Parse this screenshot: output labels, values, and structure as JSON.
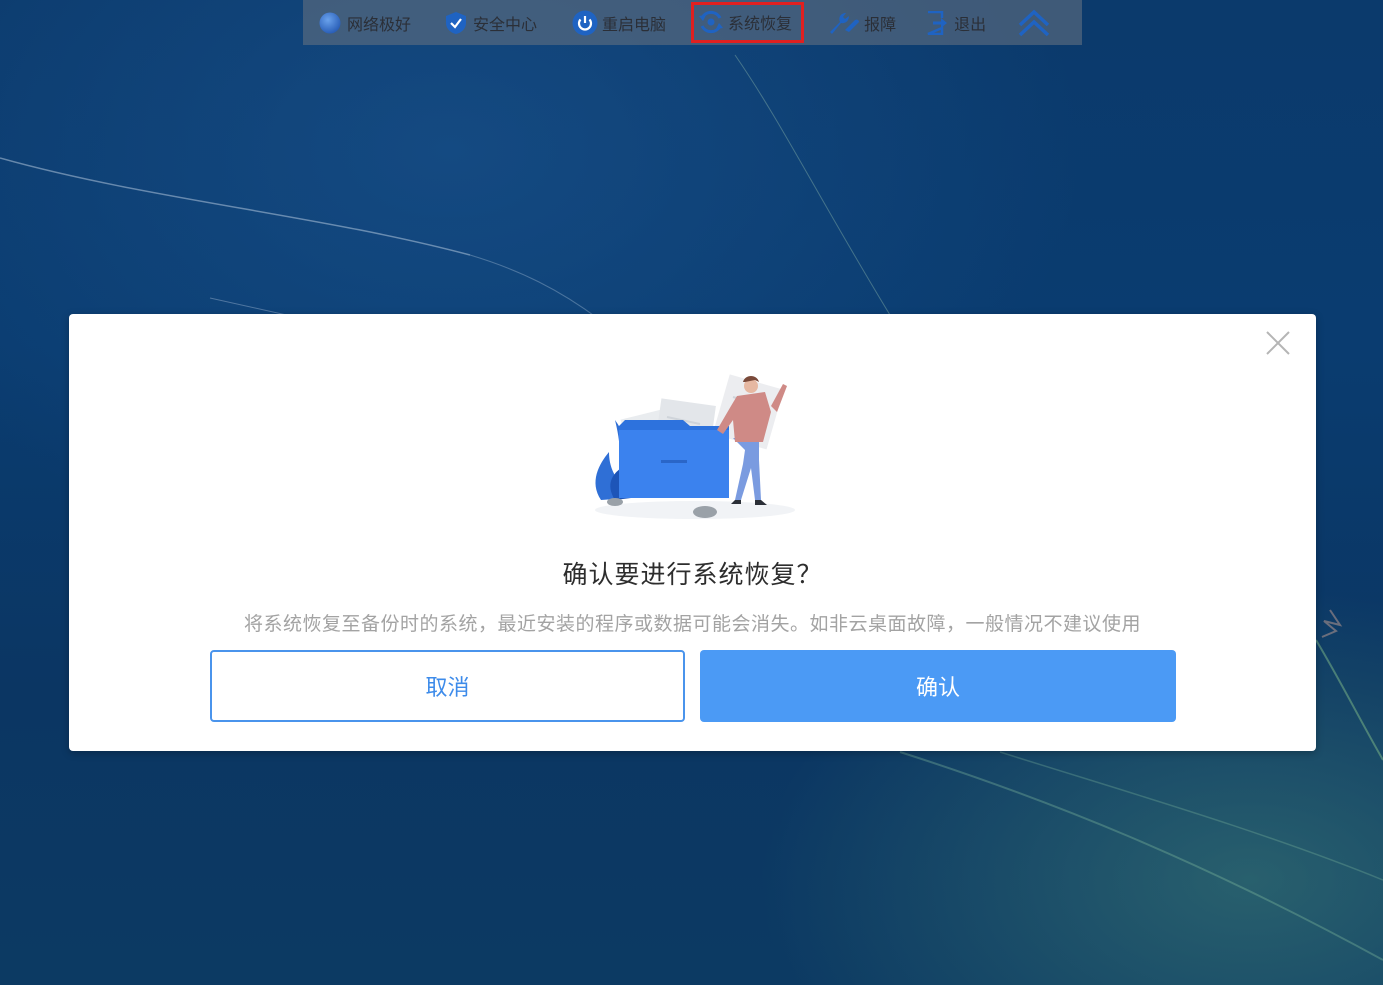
{
  "toolbar": {
    "items": [
      {
        "label": "网络极好",
        "icon": "network-status-icon"
      },
      {
        "label": "安全中心",
        "icon": "shield-icon"
      },
      {
        "label": "重启电脑",
        "icon": "power-icon"
      },
      {
        "label": "系统恢复",
        "icon": "restore-icon",
        "highlighted": true
      },
      {
        "label": "报障",
        "icon": "wrench-icon"
      },
      {
        "label": "退出",
        "icon": "exit-icon"
      }
    ],
    "collapse_icon": "double-chevron-up-icon"
  },
  "dialog": {
    "title": "确认要进行系统恢复？",
    "message": "将系统恢复至备份时的系统，最近安装的程序或数据可能会消失。如非云桌面故障，一般情况不建议使用",
    "cancel_label": "取消",
    "confirm_label": "确认",
    "close_icon": "close-icon",
    "illustration": "folder-illustration"
  },
  "colors": {
    "primary": "#4b9af5",
    "highlight_border": "#e02020",
    "toolbar_icon": "#1f63c2"
  }
}
